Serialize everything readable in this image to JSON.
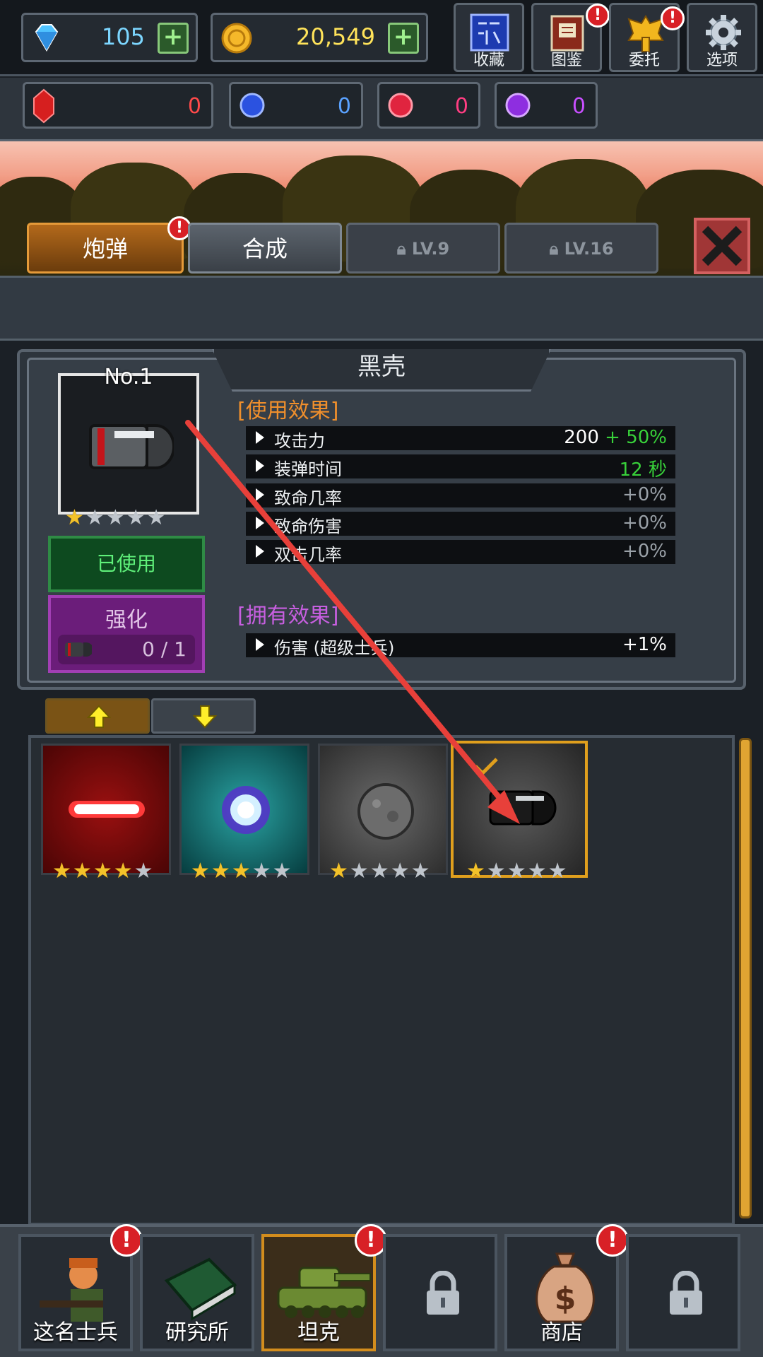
{
  "currency": {
    "diamonds": "105",
    "coins": "20,549"
  },
  "top_buttons": {
    "collection": "收藏",
    "encyclopedia": "图鉴",
    "commission": "委托",
    "options": "选项"
  },
  "gems": [
    {
      "name": "red-gem",
      "value": "0",
      "color": "#ff4a4a"
    },
    {
      "name": "blue-gem",
      "value": "0",
      "color": "#5aa2ff"
    },
    {
      "name": "pink-gem",
      "value": "0",
      "color": "#ff3d82"
    },
    {
      "name": "purple-gem",
      "value": "0",
      "color": "#c84fff"
    }
  ],
  "tabs": {
    "shell": "炮弹",
    "combine": "合成",
    "lock1": "LV.9",
    "lock2": "LV.16"
  },
  "item": {
    "name": "黑壳",
    "number": "No.1",
    "stars": 1,
    "used_label": "已使用",
    "enhance_label": "强化",
    "enhance_count": "0 / 1"
  },
  "use_effect": {
    "title": "[使用效果]",
    "stats": [
      {
        "name": "攻击力",
        "value": "200",
        "bonus": "+ 50%"
      },
      {
        "name": "装弹时间",
        "value": "12 秒"
      },
      {
        "name": "致命几率",
        "value": "+0%"
      },
      {
        "name": "致命伤害",
        "value": "+0%"
      },
      {
        "name": "双击几率",
        "value": "+0%"
      }
    ]
  },
  "own_effect": {
    "title": "[拥有效果]",
    "stats": [
      {
        "name": "伤害 (超级士兵)",
        "value": "+1%"
      }
    ]
  },
  "inventory": [
    {
      "name": "laser-shell",
      "stars": 4
    },
    {
      "name": "energy-shell",
      "stars": 3
    },
    {
      "name": "stone-shell",
      "stars": 1
    },
    {
      "name": "black-shell",
      "stars": 1,
      "selected": true
    }
  ],
  "nav": {
    "soldier": "这名士兵",
    "lab": "研究所",
    "tank": "坦克",
    "shop": "商店"
  },
  "colors": {
    "accent_orange": "#e09f1d",
    "green_value": "#38d13a",
    "gray_value": "#9aa1a8"
  }
}
